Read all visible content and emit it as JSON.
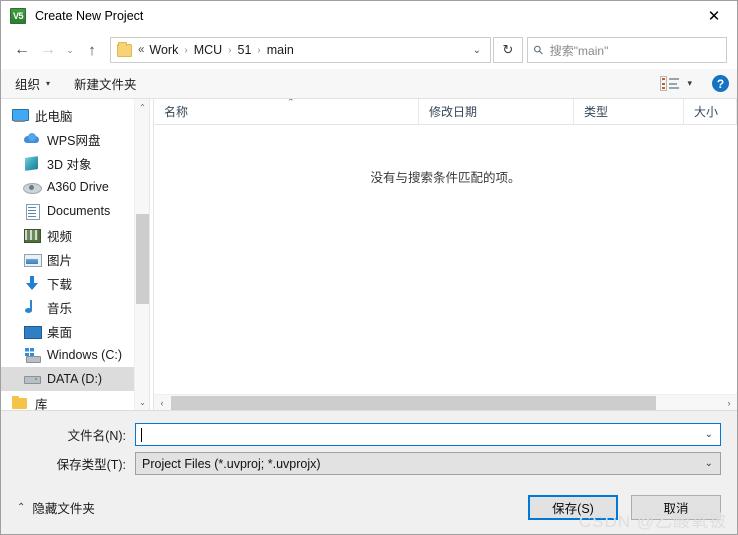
{
  "window": {
    "title": "Create New Project",
    "icon": "uvision-icon",
    "icon_label": "V5",
    "close_label": "✕"
  },
  "nav": {
    "back": "←",
    "forward": "→",
    "recent": "⌄",
    "up": "↑",
    "refresh": "↻",
    "breadcrumb_prefix": "«",
    "breadcrumb": [
      "Work",
      "MCU",
      "51",
      "main"
    ],
    "breadcrumb_separator": "›",
    "breadcrumb_caret": "⌄"
  },
  "search": {
    "placeholder": "搜索\"main\"",
    "icon": "search-icon"
  },
  "commandbar": {
    "organize": "组织",
    "organize_caret": "▾",
    "new_folder": "新建文件夹",
    "view_caret": "▾",
    "help": "?"
  },
  "sidebar": {
    "items": [
      {
        "label": "此电脑",
        "icon": "this-pc-icon",
        "icon_class": "ic-pc",
        "root": true,
        "selected": false
      },
      {
        "label": "WPS网盘",
        "icon": "cloud-icon",
        "icon_class": "ic-cloud",
        "root": false,
        "selected": false
      },
      {
        "label": "3D 对象",
        "icon": "3d-objects-icon",
        "icon_class": "ic-3d",
        "root": false,
        "selected": false
      },
      {
        "label": "A360 Drive",
        "icon": "a360-drive-icon",
        "icon_class": "ic-eye",
        "root": false,
        "selected": false
      },
      {
        "label": "Documents",
        "icon": "documents-icon",
        "icon_class": "ic-doc",
        "root": false,
        "selected": false
      },
      {
        "label": "视频",
        "icon": "videos-icon",
        "icon_class": "ic-film",
        "root": false,
        "selected": false
      },
      {
        "label": "图片",
        "icon": "pictures-icon",
        "icon_class": "ic-pic",
        "root": false,
        "selected": false
      },
      {
        "label": "下载",
        "icon": "downloads-icon",
        "icon_class": "ic-dl",
        "root": false,
        "selected": false
      },
      {
        "label": "音乐",
        "icon": "music-icon",
        "icon_class": "ic-mus",
        "root": false,
        "selected": false
      },
      {
        "label": "桌面",
        "icon": "desktop-icon",
        "icon_class": "ic-desk",
        "root": false,
        "selected": false
      },
      {
        "label": "Windows (C:)",
        "icon": "windows-drive-icon",
        "icon_class": "ic-win",
        "root": false,
        "selected": false
      },
      {
        "label": "DATA (D:)",
        "icon": "drive-icon",
        "icon_class": "ic-drv",
        "root": false,
        "selected": true
      },
      {
        "label": "库",
        "icon": "library-folder-icon",
        "icon_class": "ic-fld",
        "root": true,
        "selected": false
      }
    ],
    "scroll_up": "⌃",
    "scroll_down": "⌄"
  },
  "filepane": {
    "columns": [
      "名称",
      "修改日期",
      "类型",
      "大小"
    ],
    "sort_caret": "⌃",
    "empty_message": "没有与搜索条件匹配的项。",
    "rows": [],
    "hscroll_left": "‹",
    "hscroll_right": "›"
  },
  "footer": {
    "filename_label": "文件名(N):",
    "filename_value": "",
    "filetype_label": "保存类型(T):",
    "filetype_value": "Project Files (*.uvproj; *.uvprojx)",
    "filetype_caret": "⌄",
    "filename_caret": "⌄",
    "hide_folders_caret": "⌃",
    "hide_folders": "隐藏文件夹",
    "save_button": "保存(S)",
    "cancel_button": "取消"
  },
  "watermark": "CSDN @乙酸氧铍",
  "colors": {
    "accent": "#0078d7",
    "help_blue": "#1673c4",
    "selection": "#dcdcdc",
    "footer_bg": "#f0f0f0"
  }
}
